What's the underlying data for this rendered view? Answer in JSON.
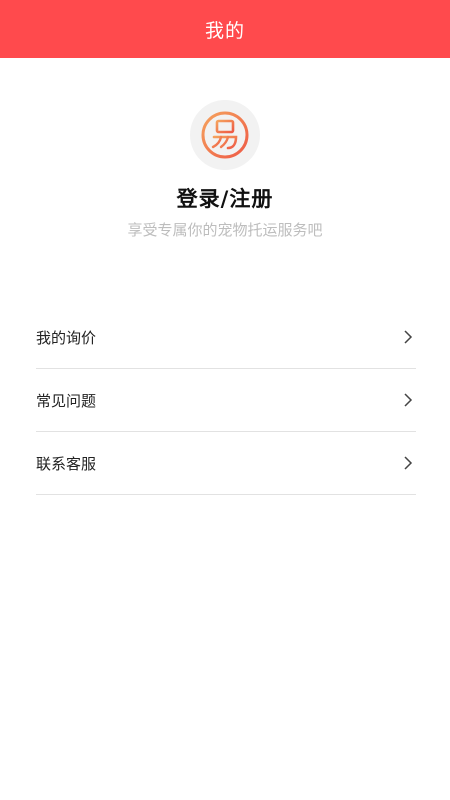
{
  "header": {
    "title": "我的"
  },
  "profile": {
    "avatar_icon": "yi-logo-icon",
    "login_label": "登录/注册",
    "subtitle": "享受专属你的宠物托运服务吧"
  },
  "menu": {
    "items": [
      {
        "label": "我的询价",
        "icon": "chevron-right-icon"
      },
      {
        "label": "常见问题",
        "icon": "chevron-right-icon"
      },
      {
        "label": "联系客服",
        "icon": "chevron-right-icon"
      }
    ]
  },
  "colors": {
    "header_bg": "#ff4a4d",
    "logo_gradient_start": "#f5a25d",
    "logo_gradient_end": "#ee5a46",
    "subtitle_text": "#bdbdbd"
  }
}
